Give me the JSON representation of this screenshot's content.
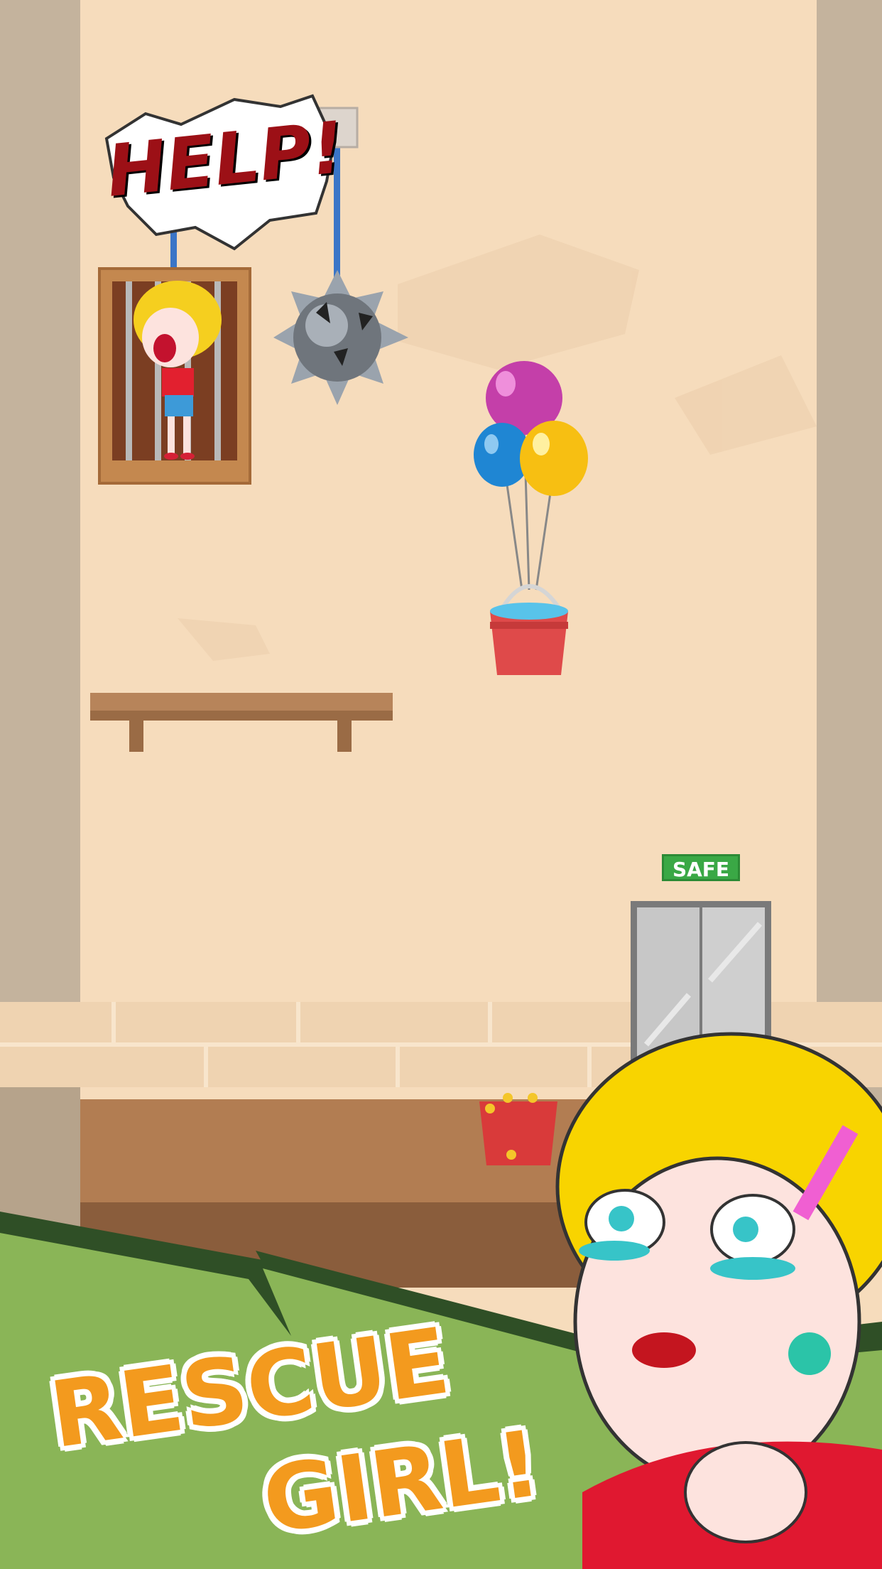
{
  "scene": {
    "help_text": "HELP!",
    "safe_sign": "SAFE"
  },
  "promo": {
    "title_line1": "RESCUE",
    "title_line2": "GIRL!"
  },
  "colors": {
    "wall": "#f6dcbc",
    "side_pillar": "#c4b39d",
    "title_orange": "#f39a1e",
    "grass": "#8ab557",
    "safe_green": "#3aa845"
  },
  "icons": {
    "cage": "cage-icon",
    "spike_ball": "spiked-ball-icon",
    "balloons": "balloon-cluster-icon",
    "bucket": "water-bucket-icon",
    "shelf": "wooden-shelf-icon",
    "elevator": "elevator-door-icon",
    "firecracker": "firecracker-icon",
    "girl_portrait": "crying-girl-icon"
  }
}
